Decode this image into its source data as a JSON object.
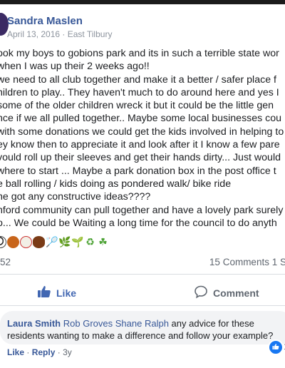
{
  "post": {
    "author": "Sandra Maslen",
    "date": "April 13, 2016",
    "separator": "·",
    "location": "East Tilbury",
    "lines": [
      "ook my boys to gobions park and its in such a terrible state wor",
      " when I was up their 2 weeks ago!!",
      "  we need to all club together and make it a better / safer place f",
      "hildren to play.. They haven't much to do around here and yes I",
      "some of the older children wreck it but it could be the little gen",
      "nce if we all pulled together.. Maybe some local businesses cou",
      "with some donations we could get the kids involved in helping to",
      "ey know then to appreciate it and look after it I know a few pare",
      "vould roll up their sleeves and get their hands dirty... Just would",
      "where to start ... Maybe a park donation box in the post office t",
      "e ball rolling / kids doing as pondered walk/ bike ride",
      "ne got any constructive ideas????",
      "nford community can pull together and have a lovely park surely",
      "o... We could be Waiting a long time for the council to do anyth"
    ],
    "emojis": [
      {
        "icon": "soccer-ball-icon",
        "kind": "soccer",
        "glyph": ""
      },
      {
        "icon": "basketball-icon",
        "kind": "basket",
        "glyph": ""
      },
      {
        "icon": "baseball-icon",
        "kind": "baseball",
        "glyph": ""
      },
      {
        "icon": "american-football-icon",
        "kind": "football",
        "glyph": ""
      },
      {
        "icon": "badminton-racket-icon",
        "kind": "racket",
        "glyph": "🏸"
      },
      {
        "icon": "herb-icon",
        "kind": "plant",
        "glyph": "🌿"
      },
      {
        "icon": "seedling-icon",
        "kind": "plant",
        "glyph": "🌱"
      },
      {
        "icon": "recycle-icon",
        "kind": "plant",
        "glyph": "♻"
      },
      {
        "icon": "shamrock-icon",
        "kind": "plant",
        "glyph": "☘"
      }
    ]
  },
  "stats": {
    "reactions": "52",
    "comments": "15 Comments",
    "shares": "1 S"
  },
  "actions": {
    "like": "Like",
    "comment": "Comment"
  },
  "comment": {
    "author": "Laura Smith",
    "tags": [
      "Rob Groves",
      "Shane Ralph"
    ],
    "text_line1": " any advice for these",
    "text_line2": "residents wanting to make a difference and follow your example?",
    "like_link": "Like",
    "separator": "·",
    "reply_link": "Reply",
    "age": "3y",
    "reaction_count": "1"
  },
  "colors": {
    "link_blue": "#385898",
    "like_blue": "#4267b2",
    "muted": "#606770",
    "bubble": "#f2f3f5"
  }
}
